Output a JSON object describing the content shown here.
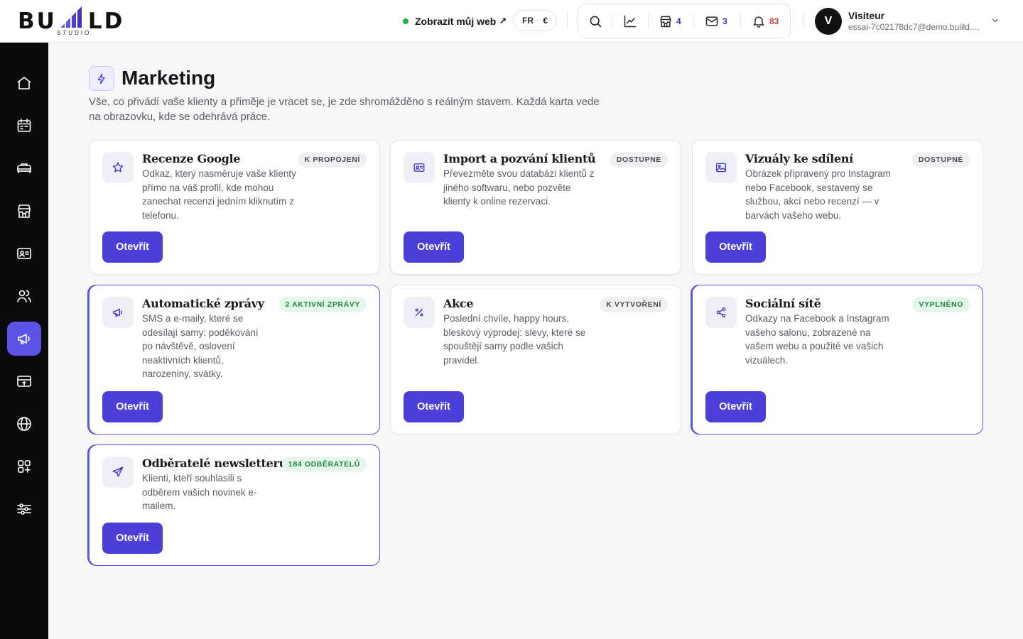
{
  "brand": {
    "name_left": "BU",
    "name_right": "LD",
    "sub": "STUDIO"
  },
  "topbar": {
    "view_site": "Zobrazit můj web",
    "view_site_arrow": "↗",
    "lang": "FR",
    "currency": "€",
    "counts": {
      "stores": "4",
      "mail": "3",
      "notifications": "83"
    },
    "colors": {
      "stores": "#3c34c8",
      "mail": "#3c34c8",
      "notifications": "#d23b3b"
    }
  },
  "user": {
    "initial": "V",
    "name": "Visiteur",
    "email": "essai-7c02178dc7@demo.buiild...."
  },
  "sidebar": {
    "items": [
      {
        "icon": "home-icon"
      },
      {
        "icon": "calendar-icon"
      },
      {
        "icon": "services-icon"
      },
      {
        "icon": "store-icon"
      },
      {
        "icon": "id-card-icon"
      },
      {
        "icon": "users-icon"
      },
      {
        "icon": "megaphone-icon",
        "active": true
      },
      {
        "icon": "billing-icon"
      },
      {
        "icon": "globe-icon"
      },
      {
        "icon": "apps-icon"
      },
      {
        "icon": "settings-sliders-icon"
      }
    ],
    "accent": "#5b54e6"
  },
  "page": {
    "title": "Marketing",
    "description": "Vše, co přivádí vaše klienty a přiměje je vracet se, je zde shromážděno s reálným stavem. Každá karta vede na obrazovku, kde se odehrává práce."
  },
  "cards": [
    {
      "title": "Recenze Google",
      "badge": "K PROPOJENÍ",
      "badge_style": "gray",
      "description": "Odkaz, který nasměruje vaše klienty přímo na váš profil, kde mohou zanechat recenzi jedním kliknutím z telefonu.",
      "button": "Otevřít",
      "icon": "star-icon"
    },
    {
      "title": "Import a pozvání klientů",
      "badge": "DOSTUPNÉ",
      "badge_style": "gray",
      "description": "Převezměte svou databázi klientů z jiného softwaru, nebo pozvěte klienty k online rezervaci.",
      "button": "Otevřít",
      "icon": "contact-card-icon"
    },
    {
      "title": "Vizuály ke sdílení",
      "badge": "DOSTUPNÉ",
      "badge_style": "gray",
      "description": "Obrázek připravený pro Instagram nebo Facebook, sestavený se službou, akcí nebo recenzí — v barvách vašeho webu.",
      "button": "Otevřít",
      "icon": "image-icon"
    },
    {
      "title": "Automatické zprávy",
      "badge": "2 AKTIVNÍ ZPRÁVY",
      "badge_style": "green",
      "description": "SMS a e-maily, které se odesílají samy: poděkování po návštěvě, oslovení neaktivních klientů, narozeniny, svátky.",
      "button": "Otevřít",
      "icon": "megaphone-icon"
    },
    {
      "title": "Akce",
      "badge": "K VYTVOŘENÍ",
      "badge_style": "gray",
      "description": "Poslední chvíle, happy hours, bleskový výprodej: slevy, které se spouštějí samy podle vašich pravidel.",
      "button": "Otevřít",
      "icon": "percent-icon"
    },
    {
      "title": "Sociální sítě",
      "badge": "VYPLNĚNO",
      "badge_style": "green",
      "description": "Odkazy na Facebook a Instagram vašeho salonu, zobrazené na vašem webu a použité ve vašich vizuálech.",
      "button": "Otevřít",
      "icon": "share-icon"
    },
    {
      "title": "Odběratelé newsletteru",
      "badge": "184 ODBĚRATELŮ",
      "badge_style": "green",
      "description": "Klienti, kteří souhlasili s odběrem vašich novinek e-mailem.",
      "button": "Otevřít",
      "icon": "send-icon"
    }
  ],
  "colors": {
    "primary_button": "#4b3fd9",
    "icon_accent": "#3c34c8",
    "badge_green": "#1d8a3d"
  }
}
